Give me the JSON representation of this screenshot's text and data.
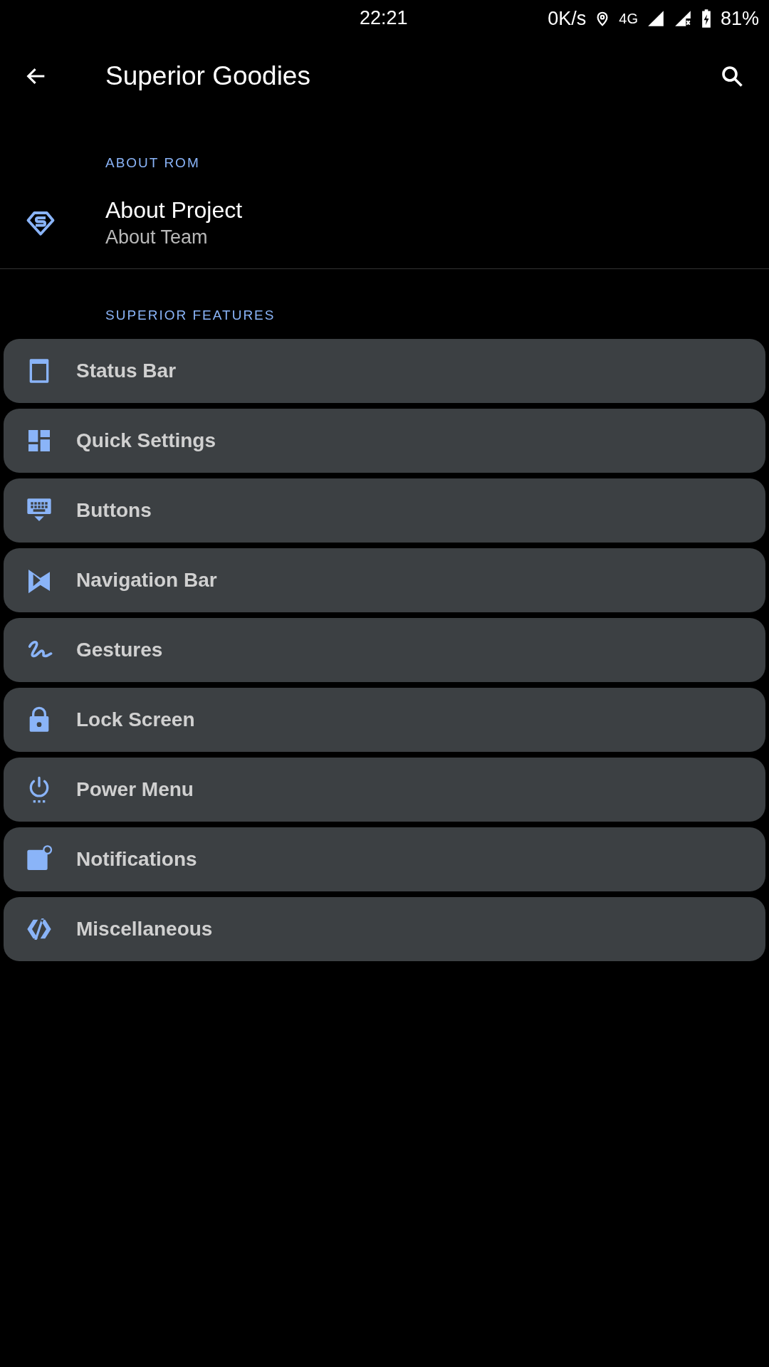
{
  "status_bar": {
    "time": "22:21",
    "speed": "0K/s",
    "network": "4G",
    "battery": "81%"
  },
  "app_bar": {
    "title": "Superior Goodies"
  },
  "about_section": {
    "header": "ABOUT ROM",
    "items": [
      {
        "title": "About Project",
        "summary": "About Team"
      }
    ]
  },
  "features_section": {
    "header": "SUPERIOR FEATURES",
    "items": [
      {
        "label": "Status Bar"
      },
      {
        "label": "Quick Settings"
      },
      {
        "label": "Buttons"
      },
      {
        "label": "Navigation Bar"
      },
      {
        "label": "Gestures"
      },
      {
        "label": "Lock Screen"
      },
      {
        "label": "Power Menu"
      },
      {
        "label": "Notifications"
      },
      {
        "label": "Miscellaneous"
      }
    ]
  }
}
